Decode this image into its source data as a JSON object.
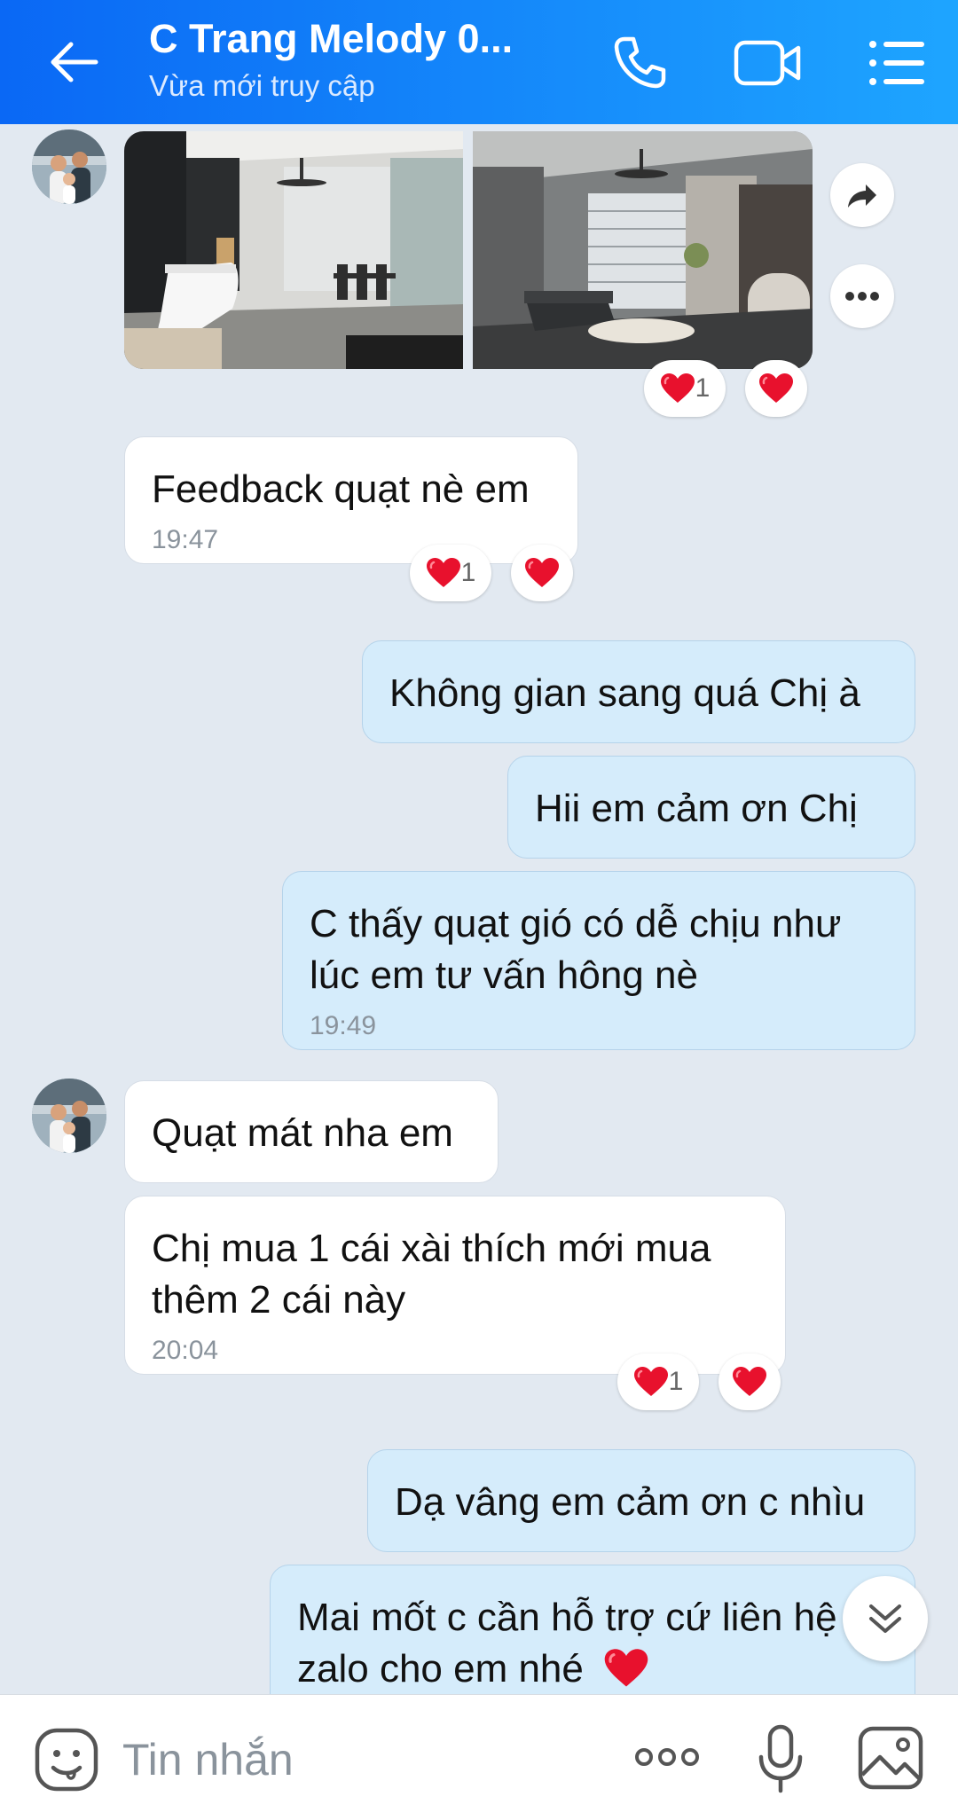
{
  "header": {
    "title": "C Trang Melody 0...",
    "status": "Vừa mới truy cập"
  },
  "messages": {
    "m1": {
      "text": "Feedback quạt nè em",
      "time": "19:47"
    },
    "m2": {
      "text": "Không gian sang quá Chị à"
    },
    "m3": {
      "text": "Hii em cảm ơn Chị"
    },
    "m4": {
      "text": "C thấy quạt gió có dễ chịu như lúc em tư vấn hông nè",
      "time": "19:49"
    },
    "m5": {
      "text": "Quạt mát nha em"
    },
    "m6": {
      "text": "Chị mua 1 cái xài thích mới mua thêm 2 cái này",
      "time": "20:04"
    },
    "m7": {
      "text": "Dạ vâng em cảm ơn c nhìu"
    },
    "m8": {
      "text": "Mai mốt c cần hỗ trợ cứ liên hệ zalo cho em nhé"
    }
  },
  "reactions": {
    "heart_count": "1"
  },
  "input": {
    "placeholder": "Tin nhắn"
  },
  "colors": {
    "header_start": "#0a68f5",
    "header_end": "#1ea5ff",
    "sent_bubble": "#d5ecfb",
    "received_bubble": "#ffffff",
    "chat_background": "#e2e9f1",
    "heart": "#e8112d"
  }
}
